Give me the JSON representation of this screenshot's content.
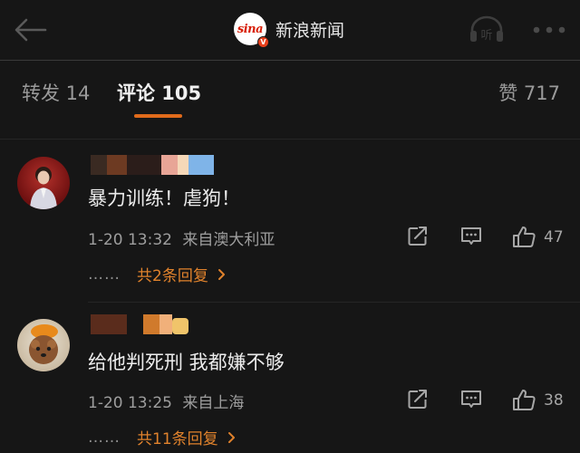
{
  "header": {
    "back_icon": "arrow-left-icon",
    "logo_text": "sina",
    "logo_badge": "V",
    "title": "新浪新闻",
    "listen_label": "听",
    "more_icon": "more-dots-icon"
  },
  "tabs": {
    "repost": "转发 14",
    "comments": "评论 105",
    "likes": "赞 717",
    "active_color": "#e06a1b"
  },
  "comments": [
    {
      "avatar": "user-avatar",
      "text": "暴力训练！虐狗！",
      "time": "1-20 13:32",
      "location": "来自澳大利亚",
      "likes": "47",
      "replies_dots": "……",
      "replies_label": "共2条回复"
    },
    {
      "avatar": "dog-avatar",
      "text": "给他判死刑 我都嫌不够",
      "time": "1-20 13:25",
      "location": "来自上海",
      "likes": "38",
      "replies_dots": "……",
      "replies_label": "共11条回复"
    }
  ],
  "colors": {
    "background": "#161616",
    "accent": "#e0822c",
    "text": "#ececec",
    "muted": "#9e9e9e"
  }
}
